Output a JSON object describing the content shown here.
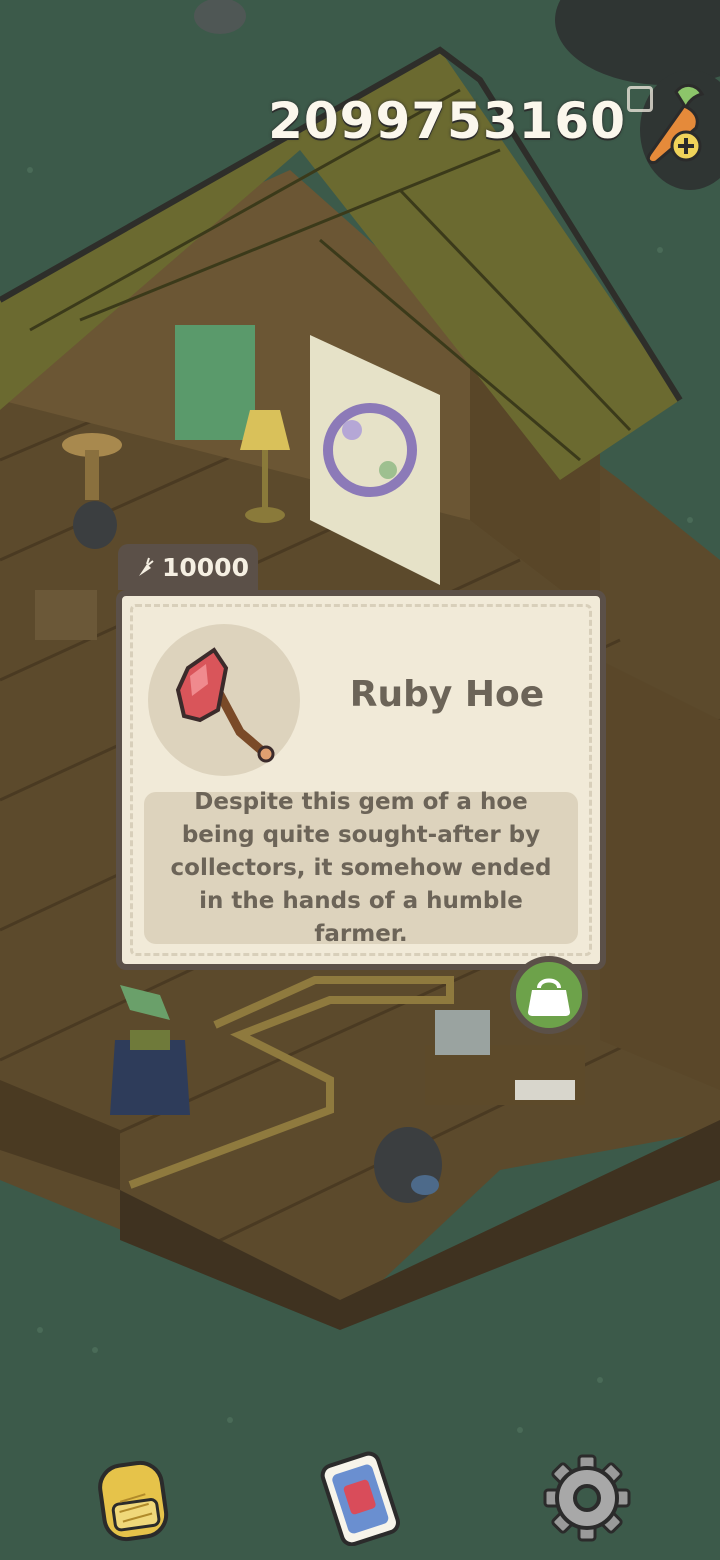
{
  "hud": {
    "currency_amount": "2099753160",
    "currency_icon": "carrot-plus-icon"
  },
  "item_card": {
    "price": "10000",
    "price_icon": "carrot-icon",
    "name": "Ruby Hoe",
    "item_icon": "ruby-hoe-icon",
    "description": "Despite this gem of a hoe being quite sought-after by collectors, it somehow ended in the hands of a humble farmer.",
    "buy_icon": "shopping-bag-icon",
    "colors": {
      "card_bg": "#f1ead8",
      "border": "#5b5048",
      "text": "#6c6458",
      "buy": "#6da24a",
      "ruby": "#d9555a"
    }
  },
  "bottom_bar": {
    "items": [
      {
        "icon": "backpack-icon"
      },
      {
        "icon": "phone-icon"
      },
      {
        "icon": "gear-icon"
      }
    ]
  }
}
